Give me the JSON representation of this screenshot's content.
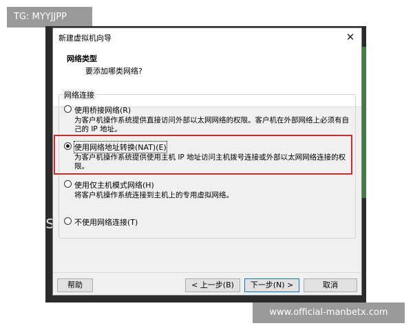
{
  "overlay_tag": "TG: MYYJJPP",
  "watermark": "www.official-manbetx.com",
  "background": {
    "glyph": "s"
  },
  "dialog": {
    "title": "新建虚拟机向导",
    "close_symbol": "✕",
    "header": {
      "title": "网络类型",
      "subtitle": "要添加哪类网络?"
    },
    "group_label": "网络连接",
    "options": [
      {
        "label": "使用桥接网络(R)",
        "description": "为客户机操作系统提供直接访问外部以太网网络的权限。客户机在外部网络上必须有自己的 IP 地址。",
        "selected": false
      },
      {
        "label": "使用网络地址转换(NAT)(E)",
        "description": "为客户机操作系统提供使用主机 IP 地址访问主机拨号连接或外部以太网网络连接的权限。",
        "selected": true
      },
      {
        "label": "使用仅主机模式网络(H)",
        "description": "将客户机操作系统连接到主机上的专用虚拟网络。",
        "selected": false
      },
      {
        "label": "不使用网络连接(T)",
        "description": "",
        "selected": false
      }
    ],
    "buttons": {
      "help": "帮助",
      "back": "< 上一步(B)",
      "next": "下一步(N) >",
      "cancel": "取消"
    }
  },
  "colors": {
    "highlight_box": "#d9262c",
    "primary_button_border": "#0078d7",
    "dialog_background": "#f0f0f0"
  }
}
